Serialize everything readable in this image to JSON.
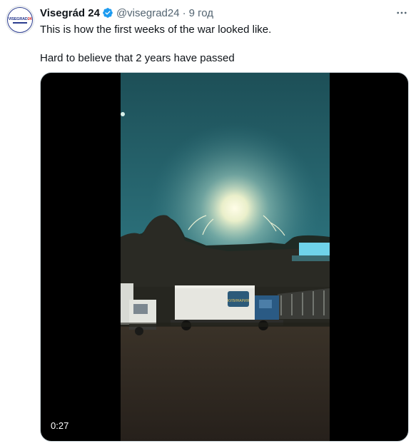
{
  "author": {
    "name": "Visegrád 24",
    "handle": "@visegrad24",
    "time": "9 год",
    "avatar_text_main": "VISEGRAD",
    "avatar_text_num": "24"
  },
  "tweet": {
    "line1": "This is how the first weeks of the war looked like.",
    "line2": "Hard to believe that 2 years have passed"
  },
  "media": {
    "duration": "0:27",
    "truck_logo_text": "КУЛИНАРИЯ"
  },
  "icons": {
    "verified": "verified-badge-icon",
    "more": "more-icon"
  },
  "colors": {
    "verified": "#1d9bf0",
    "secondary_text": "#536471"
  }
}
